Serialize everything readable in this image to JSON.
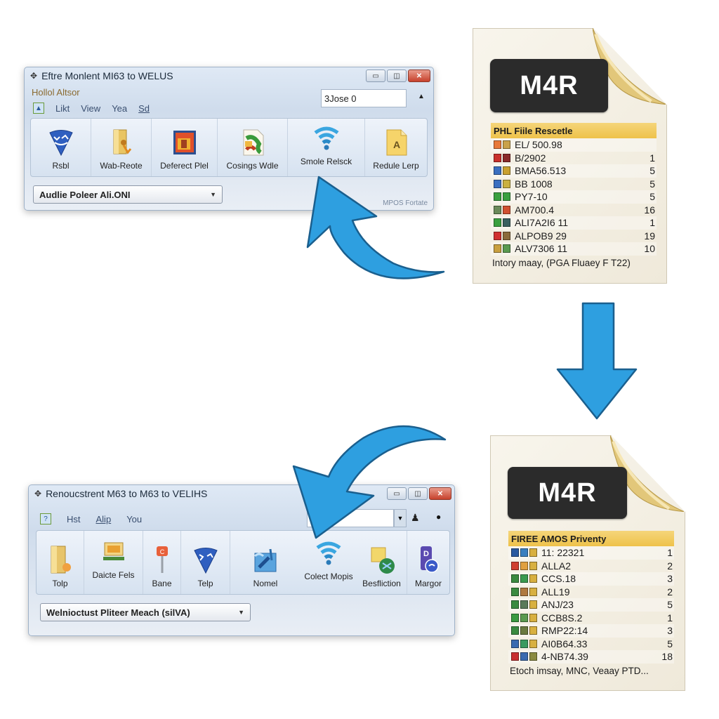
{
  "top_window": {
    "title": "Eftre Monlent MI63 to WELUS",
    "menu_top": "Hollol  Altsor",
    "menu_items": [
      "Likt",
      "View",
      "Yea",
      "Sd"
    ],
    "search_value": "3Jose 0",
    "ribbon": [
      {
        "label": "Rsbl",
        "icon": "shield-icon"
      },
      {
        "label": "Wab-Reote",
        "icon": "folder-icon"
      },
      {
        "label": "Deferect Plel",
        "icon": "picture-icon"
      },
      {
        "label": "Cosings Wdle",
        "icon": "document-icon"
      },
      {
        "label": "Smole Relsck",
        "icon": "wifi-icon"
      },
      {
        "label": "Redule Lerp",
        "icon": "file-a-icon"
      }
    ],
    "combo_value": "Audlie Poleer Ali.ONI",
    "footnote": "MPOS Fortate"
  },
  "bottom_window": {
    "title": "Renoucstrent M63 to M63 to VELIHS",
    "menu_items": [
      "Hst",
      "Alip",
      "You"
    ],
    "search_value": "",
    "ribbon": [
      {
        "label": "Tolp",
        "icon": "folder-icon"
      },
      {
        "label": "Daicte Fels",
        "icon": "picture-icon"
      },
      {
        "label": "Bane",
        "icon": "pin-icon"
      },
      {
        "label": "Telp",
        "icon": "shield-icon"
      },
      {
        "label": "Nomel",
        "icon": "document-icon"
      },
      {
        "label": "Colect Mopis",
        "icon": "wifi-icon"
      },
      {
        "label": "Besfliction",
        "icon": "globe-folder-icon"
      },
      {
        "label": "Margor",
        "icon": "user-icon"
      }
    ],
    "combo_value": "Welnioctust Pliteer Meach (silVA)"
  },
  "top_doc": {
    "badge": "M4R",
    "header": "PHL Fiile Rescetle",
    "rows": [
      {
        "name": "EL/ 500.98",
        "num": "",
        "colors": [
          "#e8793a",
          "#c9a24a"
        ]
      },
      {
        "name": "B/2902",
        "num": "1",
        "colors": [
          "#c9302c",
          "#8a2a2a"
        ]
      },
      {
        "name": "BMA56.513",
        "num": "5",
        "colors": [
          "#3a6fc0",
          "#c9a030"
        ]
      },
      {
        "name": "BB 1008",
        "num": "5",
        "colors": [
          "#3a6fc0",
          "#c9b040"
        ]
      },
      {
        "name": "PY7-10",
        "num": "5",
        "colors": [
          "#3aa040",
          "#3aa040"
        ]
      },
      {
        "name": "AM700.4",
        "num": "16",
        "colors": [
          "#6a8a5a",
          "#d05030"
        ]
      },
      {
        "name": "ALI7A2I6 11",
        "num": "1",
        "colors": [
          "#3aa040",
          "#3a6060"
        ]
      },
      {
        "name": "ALPOB9 29",
        "num": "19",
        "colors": [
          "#d03030",
          "#8a6a3a"
        ]
      },
      {
        "name": "ALV7306 11",
        "num": "10",
        "colors": [
          "#c9a040",
          "#5a9a50"
        ]
      }
    ],
    "footer": "Intory maay, (PGA Fluaey F T22)"
  },
  "bottom_doc": {
    "badge": "M4R",
    "header": "FIREE AMOS Priventy",
    "rows": [
      {
        "name": "11: 22321",
        "num": "1",
        "colors": [
          "#2a5aa0",
          "#3a80c0",
          "#d8b040"
        ]
      },
      {
        "name": "ALLA2",
        "num": "2",
        "colors": [
          "#d04030",
          "#e0a040",
          "#d8b040"
        ]
      },
      {
        "name": "CCS.18",
        "num": "3",
        "colors": [
          "#3a8a40",
          "#3a9a50",
          "#d8b040"
        ]
      },
      {
        "name": "ALL19",
        "num": "2",
        "colors": [
          "#3a8a40",
          "#b07a40",
          "#d8b040"
        ]
      },
      {
        "name": "ANJ/23",
        "num": "5",
        "colors": [
          "#3a8a40",
          "#5a7a5a",
          "#d8b040"
        ]
      },
      {
        "name": "CCB8S.2",
        "num": "1",
        "colors": [
          "#3a9a40",
          "#5a9a50",
          "#d8b040"
        ]
      },
      {
        "name": "RMP22:14",
        "num": "3",
        "colors": [
          "#3a8a40",
          "#6a7a40",
          "#d8b040"
        ]
      },
      {
        "name": "AI0B64.33",
        "num": "5",
        "colors": [
          "#3a6ab0",
          "#3a9a60",
          "#d8b040"
        ]
      },
      {
        "name": "4-NB74.39",
        "num": "18",
        "colors": [
          "#c83030",
          "#3a6ab0",
          "#8a8a40"
        ]
      }
    ],
    "footer": "Etoch imsay, MNC, Veaay PTD..."
  },
  "colors": {
    "arrow_fill": "#2e9fe0",
    "arrow_stroke": "#1a5f8e",
    "badge_bg": "#2b2b2b",
    "list_header": "#f0c64e"
  }
}
